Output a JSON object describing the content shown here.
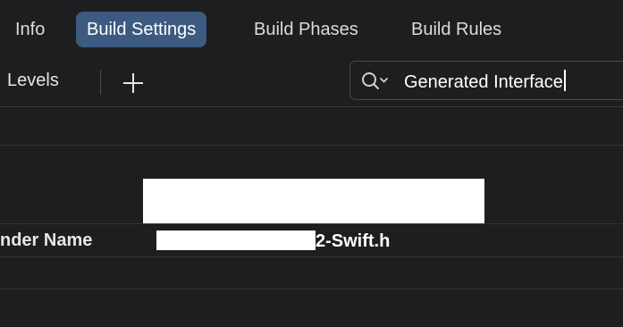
{
  "tabs": [
    {
      "label": "Info",
      "active": false
    },
    {
      "label": "Build Settings",
      "active": true
    },
    {
      "label": "Build Phases",
      "active": false
    },
    {
      "label": "Build Rules",
      "active": false
    }
  ],
  "toolbar": {
    "levels_label": "Levels",
    "add_icon": "plus-icon",
    "search_icon": "search-icon",
    "search_value": "Generated Interface"
  },
  "setting": {
    "label": "nder Name",
    "value_suffix": "2-Swift.h"
  },
  "colors": {
    "active_tab": "#3d5a80",
    "background": "#1e1e20"
  }
}
